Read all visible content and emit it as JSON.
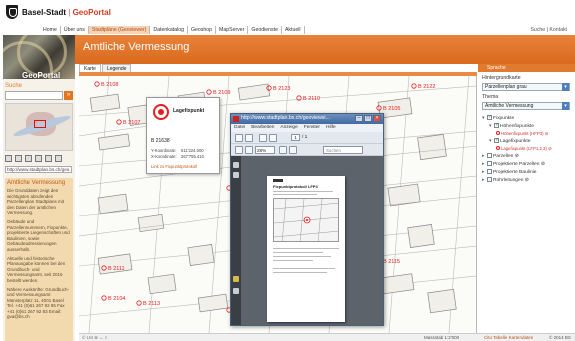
{
  "header": {
    "brand": "Basel-Stadt",
    "brand_sep": "|",
    "brand_sub": "GeoPortal",
    "nav": [
      "Home",
      "Über uns",
      "Stadtpläne (Geoviewer)",
      "Datenkatalog",
      "Geoshop",
      "MapServer",
      "Geodienste",
      "Aktuell"
    ],
    "nav_right": "Suche | Kontakt",
    "banner_title": "Amtliche Vermessung",
    "geoportal_label": "GeoPortal"
  },
  "sidebar": {
    "search_label": "Suche",
    "search_go": "»",
    "url": "http://www.stadtplan.bs.ch/geo...",
    "info_title": "Amtliche Vermessung",
    "info_paragraphs": [
      "Die Grunddaten zeigt den wichtigsten abrufenden Parzellenplan Stadtplans mit den Daten der amtlichen Vermessung.",
      "Gebäude und Parzellennummern, Fixpunkte, projektierte Liegenschaften und Baulinien, sowie Gebäudeadressierungen ausserhalb.",
      "Aktuelle und historische Planausgabe können bei den Grundbuch- und Vermessungsamt, seit 2016 bestellt werden.",
      "Nähere Auskünfte: Grundbuch- und Vermessungsamt Münsterplatz 11, 4001 Basel Tel. +41 (0)61 267 92 85 Fax +41 (0)61 267 92 83 Email: gva@bs.ch"
    ]
  },
  "tabs": [
    "Karte",
    "Legende"
  ],
  "lang": "Sprache",
  "map": {
    "labels": [
      "2108",
      "2107",
      "2109",
      "2123",
      "2110",
      "2105",
      "2122",
      "2106",
      "2115",
      "2111",
      "2104",
      "2113",
      "2112"
    ],
    "status_left": "© LM  ⊕  ↔  ⌕",
    "scale": "Massstab 1:2'000",
    "copyright": "Cito Tabelle Kartendaten",
    "coords": "© 2014 BS"
  },
  "popup": {
    "title": "Lagefixpunkt",
    "id": "B 21638",
    "rows": [
      {
        "label": "Y-Koordinate:",
        "value": "611'224.000"
      },
      {
        "label": "X-Koordinate:",
        "value": "267'755.410"
      }
    ],
    "link": "Link zu Fixpunktprotokoll"
  },
  "pdf": {
    "title": "http://www.stadtplan.bs.ch/geoviewsi...",
    "menu": [
      "Datei",
      "Bearbeiten",
      "Anzeige",
      "Fenster",
      "Hilfe"
    ],
    "page": "1",
    "page_total": "/ 1",
    "zoom": "28%",
    "search_placeholder": "Suchen",
    "doc_title": "Fixpunktprotokoll LFP3"
  },
  "rpanel": {
    "hintergrund_label": "Hintergrundkarte",
    "hintergrund_value": "Parzellenplan grau",
    "thema_label": "Thema",
    "thema_value": "Amtliche Vermessung",
    "layers": [
      {
        "text": "Fixpunkte",
        "level": 0,
        "checked": true
      },
      {
        "text": "Höhenfixpunkte",
        "level": 1,
        "checked": true
      },
      {
        "text": "Höhenfixpunkt (HFP3) ⊘",
        "level": 2,
        "symbol": true
      },
      {
        "text": "Lagefixpunkte",
        "level": 1,
        "checked": true
      },
      {
        "text": "Lagefixpunkt (LFP1,2,3) ⊘",
        "level": 2,
        "symbol": true
      },
      {
        "text": "Parzellen ⊘",
        "level": 0,
        "checked": false
      },
      {
        "text": "Projektierte Parzellen ⊘",
        "level": 0,
        "checked": false
      },
      {
        "text": "Projektierte Baulinie",
        "level": 0,
        "checked": false
      },
      {
        "text": "Rohrleitungen ⊘",
        "level": 0,
        "checked": false
      }
    ]
  },
  "colors": {
    "accent_orange": "#e0761f",
    "fixpoint_red": "#e51f1f",
    "window_blue": "#3f6aa2"
  }
}
